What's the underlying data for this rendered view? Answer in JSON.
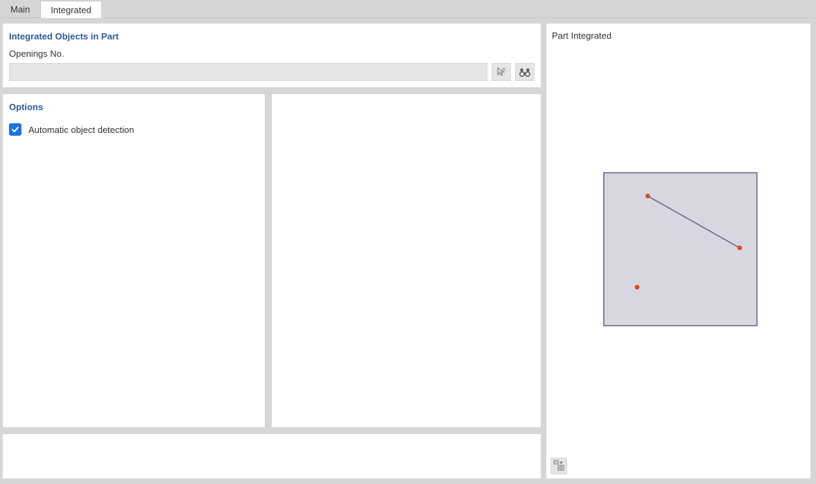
{
  "tabs": [
    {
      "label": "Main",
      "active": false
    },
    {
      "label": "Integrated",
      "active": true
    }
  ],
  "integrated": {
    "title": "Integrated Objects in Part",
    "openings_label": "Openings No.",
    "openings_value": ""
  },
  "options": {
    "title": "Options",
    "auto_detect_label": "Automatic object detection",
    "auto_detect_checked": true
  },
  "preview": {
    "title": "Part Integrated"
  }
}
